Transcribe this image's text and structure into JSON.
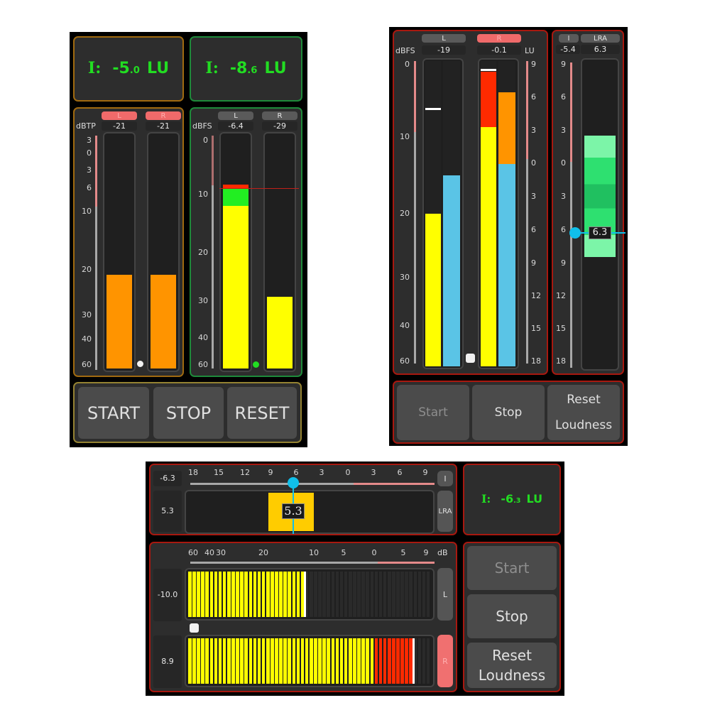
{
  "colors": {
    "orange_border": "#a06a10",
    "green_border": "#1e8a3a",
    "red_border": "#a8180f",
    "loudness_text": "#22dd22",
    "bar_orange": "#ff9400",
    "bar_yellow": "#ffff00",
    "bar_green": "#22ee22",
    "bar_red": "#ff2a00",
    "bar_blue": "#5ac4e6",
    "lra_green": "#2ee070",
    "lra_yellow": "#ffcc00",
    "cursor_cyan": "#10bfea"
  },
  "meter_a": {
    "loudness": {
      "prefix": "I:",
      "int": "-5",
      "dec": ".0",
      "unit": "LU"
    },
    "channels": [
      {
        "label": "L",
        "value": "-21",
        "clip": true,
        "level_db": 21,
        "color": "orange"
      },
      {
        "label": "R",
        "value": "-21",
        "clip": true,
        "level_db": 21,
        "color": "orange"
      }
    ],
    "scale_unit": "dBTP",
    "scale_ticks": [
      "3",
      "0",
      "3",
      "6",
      "10",
      "20",
      "30",
      "40",
      "60"
    ],
    "buttons": [
      "START",
      "STOP",
      "RESET"
    ]
  },
  "meter_b": {
    "loudness": {
      "prefix": "I:",
      "int": "-8",
      "dec": ".6",
      "unit": "LU"
    },
    "channels": [
      {
        "label": "L",
        "value": "-6.4",
        "clip": false,
        "level_db": 8,
        "color": "yellow-green-red"
      },
      {
        "label": "R",
        "value": "-29",
        "clip": false,
        "level_db": 29,
        "color": "yellow"
      }
    ],
    "scale_unit": "dBFS",
    "scale_ticks": [
      "0",
      "10",
      "20",
      "30",
      "40",
      "60"
    ]
  },
  "meter_c": {
    "channels": [
      {
        "label": "L",
        "value": "-19",
        "clip": false,
        "peak_db": 6,
        "level_db": 20,
        "loudness_lu": -1
      },
      {
        "label": "R",
        "value": "-0.1",
        "clip": true,
        "peak_db": 1,
        "level_db": 1,
        "loudness_lu": 6.5
      }
    ],
    "left_unit": "dBFS",
    "right_unit": "LU",
    "left_ticks": [
      "0",
      "10",
      "20",
      "30",
      "40",
      "60"
    ],
    "right_ticks": [
      "9",
      "6",
      "3",
      "0",
      "3",
      "6",
      "9",
      "12",
      "15",
      "18"
    ],
    "buttons": [
      {
        "label": "Start",
        "disabled": true
      },
      {
        "label": "Stop",
        "disabled": false
      },
      {
        "label": "Reset Loudness",
        "disabled": false
      }
    ]
  },
  "lra_meter": {
    "label_i": "I",
    "label_lra": "LRA",
    "value_i": "-5.4",
    "value_lra": "6.3",
    "ticks": [
      "9",
      "6",
      "3",
      "0",
      "3",
      "6",
      "9",
      "12",
      "15",
      "18"
    ],
    "cursor_value": "6.3",
    "range_top_lu": -2.5,
    "range_bottom_lu": 8.5
  },
  "meter_d": {
    "value_i": "-6.3",
    "value_lra": "5.3",
    "ticks": [
      "18",
      "15",
      "12",
      "9",
      "6",
      "3",
      "0",
      "3",
      "6",
      "9"
    ],
    "cursor_value": "5.3",
    "btn_i": "I",
    "btn_lra": "LRA",
    "loudness": {
      "prefix": "I:",
      "int": "-6",
      "dec": ".3",
      "unit": "LU"
    },
    "bar_ticks": [
      "60",
      "40",
      "30",
      "20",
      "10",
      "5",
      "0",
      "5",
      "9"
    ],
    "bar_unit": "dB",
    "channels": [
      {
        "label": "L",
        "value": "-10.0",
        "clip": false,
        "level_fraction": 0.48
      },
      {
        "label": "R",
        "value": "8.9",
        "clip": true,
        "level_fraction": 0.93
      }
    ],
    "buttons": [
      {
        "label": "Start",
        "disabled": true
      },
      {
        "label": "Stop",
        "disabled": false
      },
      {
        "label": "Reset Loudness",
        "disabled": false
      }
    ]
  }
}
